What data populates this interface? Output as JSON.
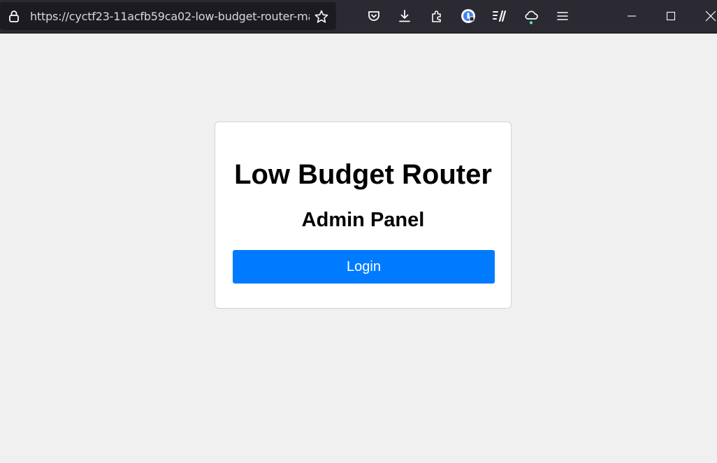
{
  "browser": {
    "url": "https://cyctf23-11acfb59ca02-low-budget-router-ma",
    "icons": [
      "lock-icon",
      "bookmark-star-icon",
      "pocket-icon",
      "download-icon",
      "extensions-icon",
      "account-icon",
      "reader-icon",
      "sync-cloud-icon",
      "menu-icon"
    ],
    "window_controls": [
      "minimize-icon",
      "maximize-icon",
      "close-icon"
    ]
  },
  "page": {
    "title": "Low Budget Router",
    "subtitle": "Admin Panel",
    "login_label": "Login"
  },
  "colors": {
    "toolbar_bg": "#2b2a33",
    "page_bg": "#f0f0f0",
    "button_bg": "#007bff",
    "sync_dot": "#54ffbd"
  }
}
